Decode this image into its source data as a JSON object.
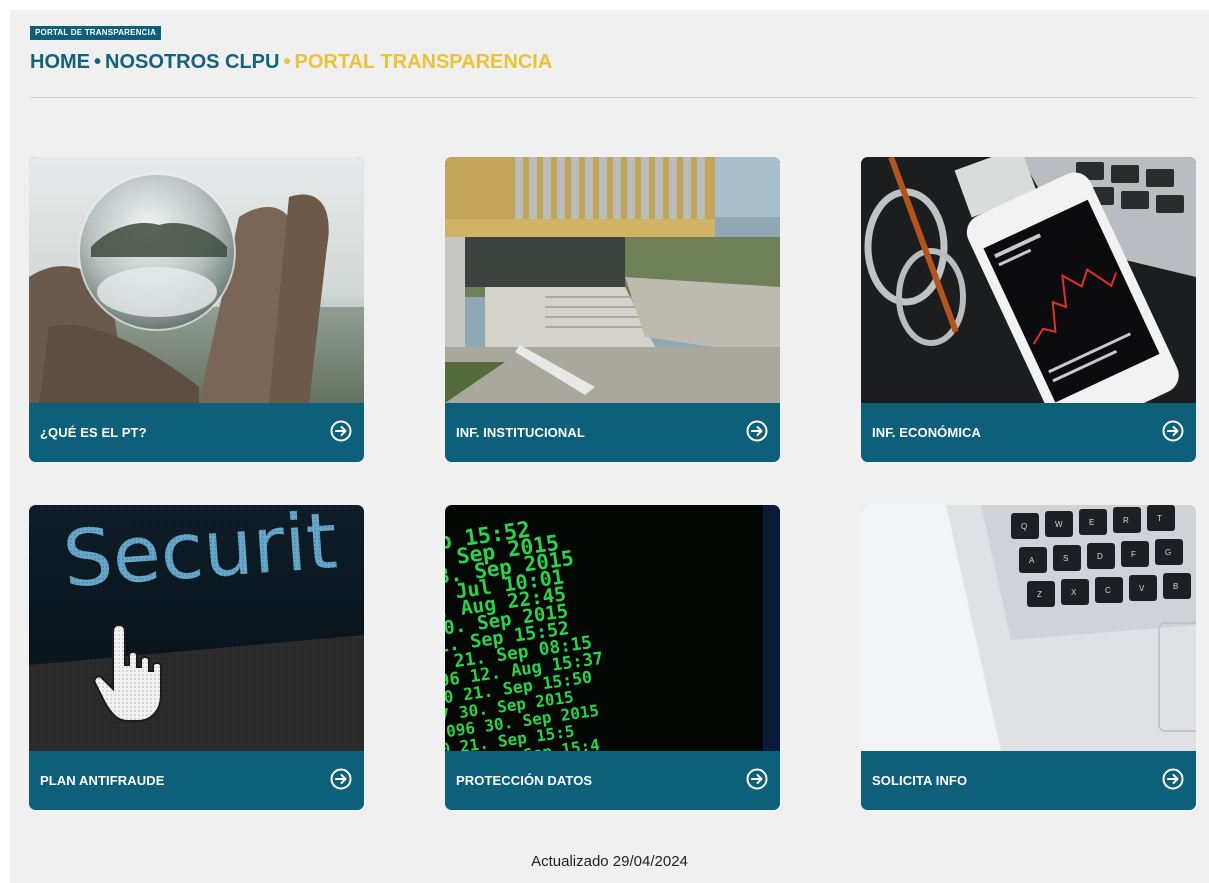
{
  "header": {
    "tag": "PORTAL DE TRANSPARENCIA",
    "breadcrumb": {
      "home": "HOME",
      "sep1": "•",
      "nosotros": "NOSOTROS CLPU",
      "sep2": "•",
      "current": "PORTAL TRANSPARENCIA"
    }
  },
  "colors": {
    "primary": "#0d5f7a",
    "accent": "#e9c33a",
    "background": "#f0f0f0"
  },
  "cards": [
    {
      "label": "¿QUÉ ES EL PT?",
      "icon": "arrow-circle-right-icon",
      "image": "crystal-ball-hand"
    },
    {
      "label": "INF. INSTITUCIONAL",
      "icon": "arrow-circle-right-icon",
      "image": "building-stairs"
    },
    {
      "label": "INF. ECONÓMICA",
      "icon": "arrow-circle-right-icon",
      "image": "phone-stock-chart"
    },
    {
      "label": "PLAN ANTIFRAUDE",
      "icon": "arrow-circle-right-icon",
      "image": "security-screen-cursor"
    },
    {
      "label": "PROTECCIÓN DATOS",
      "icon": "arrow-circle-right-icon",
      "image": "green-terminal-dates"
    },
    {
      "label": "SOLICITA INFO",
      "icon": "arrow-circle-right-icon",
      "image": "laptop-keyboard"
    }
  ],
  "terminal_lines": [
    "Sep  15:52",
    "0.  Sep 2015",
    "23.  Sep 2015",
    "3.  Jul  10:01",
    "1.  Aug  22:45",
    "30.  Sep 2015",
    "21.  Sep  15:52",
    "0 21.  Sep  08:15",
    "96 12.  Aug  15:37",
    "60 21.  Sep  15:50",
    "7  30.  Sep 2015",
    "096 30.  Sep 2015",
    "0  21.  Sep  15:5",
    "300 21.  Sep  15:4",
    "4096 23.  Aug  15:4"
  ],
  "keyboard_keys": [
    "Q",
    "W",
    "E",
    "R",
    "T",
    "A",
    "S",
    "D",
    "F",
    "G",
    "Z",
    "X",
    "C",
    "V",
    "B"
  ],
  "footer": {
    "updated": "Actualizado 29/04/2024"
  }
}
